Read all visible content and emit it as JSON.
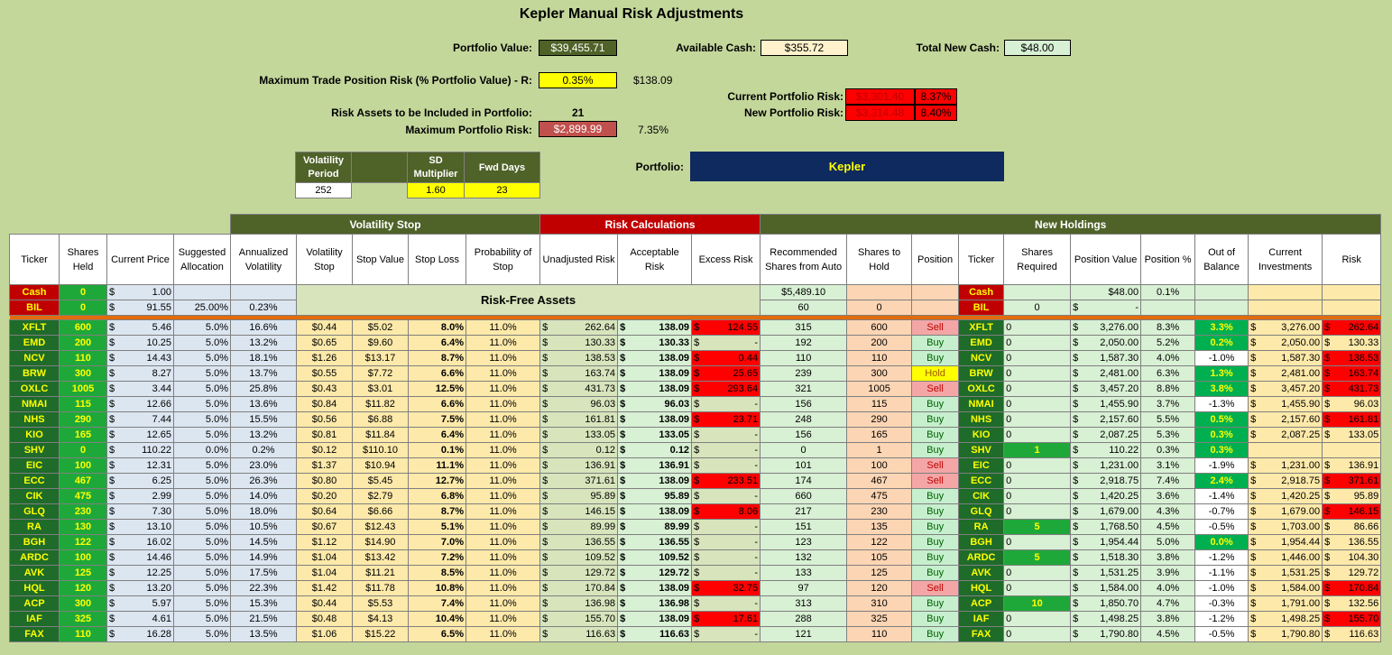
{
  "title": "Kepler Manual Risk Adjustments",
  "portfolio_value_label": "Portfolio Value:",
  "portfolio_value": "$39,455.71",
  "available_cash_label": "Available Cash:",
  "available_cash": "$355.72",
  "total_new_cash_label": "Total New Cash:",
  "total_new_cash": "$48.00",
  "max_trade_label": "Maximum Trade Position Risk (% Portfolio Value) - R:",
  "max_trade_pct": "0.35%",
  "max_trade_amt": "$138.09",
  "current_risk_label": "Current Portfolio Risk:",
  "current_risk_amt": "$3,301.40",
  "current_risk_pct": "8.37%",
  "new_risk_label": "New Portfolio Risk:",
  "new_risk_amt": "$3,314.48",
  "new_risk_pct": "8.40%",
  "risk_assets_label": "Risk Assets to be Included in Portfolio:",
  "risk_assets": "21",
  "max_portfolio_risk_label": "Maximum Portfolio Risk:",
  "max_portfolio_risk": "$2,899.99",
  "max_portfolio_risk_pct": "7.35%",
  "vol_period_label": "Volatility Period",
  "vol_period": "252",
  "sd_mult_label": "SD Multiplier",
  "sd_mult": "1.60",
  "fwd_days_label": "Fwd Days",
  "fwd_days": "23",
  "portfolio_label": "Portfolio:",
  "portfolio_name": "Kepler",
  "groups": {
    "vol": "Volatility Stop",
    "risk": "Risk Calculations",
    "new": "New Holdings"
  },
  "headers": [
    "Ticker",
    "Shares Held",
    "Current Price",
    "Suggested Allocation",
    "Annualized Volatility",
    "Volatility Stop",
    "Stop Value",
    "Stop Loss",
    "Probability of Stop",
    "Unadjusted Risk",
    "Acceptable Risk",
    "Excess Risk",
    "Recommended Shares from Auto",
    "Shares to Hold",
    "Position",
    "Ticker",
    "Shares Required",
    "Position Value",
    "Position %",
    "Out of Balance",
    "Current Investments",
    "Risk"
  ],
  "risk_free_label": "Risk-Free Assets",
  "cash_row": {
    "ticker": "Cash",
    "shares": "0",
    "price": "1.00",
    "rec": "$5,489.10",
    "ticker2": "Cash",
    "pos_value": "$48.00",
    "pos_pct": "0.1%"
  },
  "bil_row": {
    "ticker": "BIL",
    "shares": "0",
    "price": "91.55",
    "alloc": "25.00%",
    "vol": "0.23%",
    "rec": "60",
    "hold": "0",
    "ticker2": "BIL",
    "req": "0",
    "pos_value": "-"
  },
  "rows": [
    [
      "XFLT",
      "600",
      "5.46",
      "5.0%",
      "16.6%",
      "$0.44",
      "$5.02",
      "8.0%",
      "11.0%",
      "262.64",
      "138.09",
      "124.55",
      "315",
      "600",
      "Sell",
      "XFLT",
      "0",
      "3,276.00",
      "8.3%",
      "3.3%",
      "3,276.00",
      "262.64"
    ],
    [
      "EMD",
      "200",
      "10.25",
      "5.0%",
      "13.2%",
      "$0.65",
      "$9.60",
      "6.4%",
      "11.0%",
      "130.33",
      "130.33",
      "-",
      "192",
      "200",
      "Buy",
      "EMD",
      "0",
      "2,050.00",
      "5.2%",
      "0.2%",
      "2,050.00",
      "130.33"
    ],
    [
      "NCV",
      "110",
      "14.43",
      "5.0%",
      "18.1%",
      "$1.26",
      "$13.17",
      "8.7%",
      "11.0%",
      "138.53",
      "138.09",
      "0.44",
      "110",
      "110",
      "Buy",
      "NCV",
      "0",
      "1,587.30",
      "4.0%",
      "-1.0%",
      "1,587.30",
      "138.53"
    ],
    [
      "BRW",
      "300",
      "8.27",
      "5.0%",
      "13.7%",
      "$0.55",
      "$7.72",
      "6.6%",
      "11.0%",
      "163.74",
      "138.09",
      "25.65",
      "239",
      "300",
      "Hold",
      "BRW",
      "0",
      "2,481.00",
      "6.3%",
      "1.3%",
      "2,481.00",
      "163.74"
    ],
    [
      "OXLC",
      "1005",
      "3.44",
      "5.0%",
      "25.8%",
      "$0.43",
      "$3.01",
      "12.5%",
      "11.0%",
      "431.73",
      "138.09",
      "293.64",
      "321",
      "1005",
      "Sell",
      "OXLC",
      "0",
      "3,457.20",
      "8.8%",
      "3.8%",
      "3,457.20",
      "431.73"
    ],
    [
      "NMAI",
      "115",
      "12.66",
      "5.0%",
      "13.6%",
      "$0.84",
      "$11.82",
      "6.6%",
      "11.0%",
      "96.03",
      "96.03",
      "-",
      "156",
      "115",
      "Buy",
      "NMAI",
      "0",
      "1,455.90",
      "3.7%",
      "-1.3%",
      "1,455.90",
      "96.03"
    ],
    [
      "NHS",
      "290",
      "7.44",
      "5.0%",
      "15.5%",
      "$0.56",
      "$6.88",
      "7.5%",
      "11.0%",
      "161.81",
      "138.09",
      "23.71",
      "248",
      "290",
      "Buy",
      "NHS",
      "0",
      "2,157.60",
      "5.5%",
      "0.5%",
      "2,157.60",
      "161.81"
    ],
    [
      "KIO",
      "165",
      "12.65",
      "5.0%",
      "13.2%",
      "$0.81",
      "$11.84",
      "6.4%",
      "11.0%",
      "133.05",
      "133.05",
      "-",
      "156",
      "165",
      "Buy",
      "KIO",
      "0",
      "2,087.25",
      "5.3%",
      "0.3%",
      "2,087.25",
      "133.05"
    ],
    [
      "SHV",
      "0",
      "110.22",
      "0.0%",
      "0.2%",
      "$0.12",
      "$110.10",
      "0.1%",
      "11.0%",
      "0.12",
      "0.12",
      "-",
      "0",
      "1",
      "Buy",
      "SHV",
      "1",
      "110.22",
      "0.3%",
      "0.3%",
      "",
      ""
    ],
    [
      "EIC",
      "100",
      "12.31",
      "5.0%",
      "23.0%",
      "$1.37",
      "$10.94",
      "11.1%",
      "11.0%",
      "136.91",
      "136.91",
      "-",
      "101",
      "100",
      "Sell",
      "EIC",
      "0",
      "1,231.00",
      "3.1%",
      "-1.9%",
      "1,231.00",
      "136.91"
    ],
    [
      "ECC",
      "467",
      "6.25",
      "5.0%",
      "26.3%",
      "$0.80",
      "$5.45",
      "12.7%",
      "11.0%",
      "371.61",
      "138.09",
      "233.51",
      "174",
      "467",
      "Sell",
      "ECC",
      "0",
      "2,918.75",
      "7.4%",
      "2.4%",
      "2,918.75",
      "371.61"
    ],
    [
      "CIK",
      "475",
      "2.99",
      "5.0%",
      "14.0%",
      "$0.20",
      "$2.79",
      "6.8%",
      "11.0%",
      "95.89",
      "95.89",
      "-",
      "660",
      "475",
      "Buy",
      "CIK",
      "0",
      "1,420.25",
      "3.6%",
      "-1.4%",
      "1,420.25",
      "95.89"
    ],
    [
      "GLQ",
      "230",
      "7.30",
      "5.0%",
      "18.0%",
      "$0.64",
      "$6.66",
      "8.7%",
      "11.0%",
      "146.15",
      "138.09",
      "8.06",
      "217",
      "230",
      "Buy",
      "GLQ",
      "0",
      "1,679.00",
      "4.3%",
      "-0.7%",
      "1,679.00",
      "146.15"
    ],
    [
      "RA",
      "130",
      "13.10",
      "5.0%",
      "10.5%",
      "$0.67",
      "$12.43",
      "5.1%",
      "11.0%",
      "89.99",
      "89.99",
      "-",
      "151",
      "135",
      "Buy",
      "RA",
      "5",
      "1,768.50",
      "4.5%",
      "-0.5%",
      "1,703.00",
      "86.66"
    ],
    [
      "BGH",
      "122",
      "16.02",
      "5.0%",
      "14.5%",
      "$1.12",
      "$14.90",
      "7.0%",
      "11.0%",
      "136.55",
      "136.55",
      "-",
      "123",
      "122",
      "Buy",
      "BGH",
      "0",
      "1,954.44",
      "5.0%",
      "0.0%",
      "1,954.44",
      "136.55"
    ],
    [
      "ARDC",
      "100",
      "14.46",
      "5.0%",
      "14.9%",
      "$1.04",
      "$13.42",
      "7.2%",
      "11.0%",
      "109.52",
      "109.52",
      "-",
      "132",
      "105",
      "Buy",
      "ARDC",
      "5",
      "1,518.30",
      "3.8%",
      "-1.2%",
      "1,446.00",
      "104.30"
    ],
    [
      "AVK",
      "125",
      "12.25",
      "5.0%",
      "17.5%",
      "$1.04",
      "$11.21",
      "8.5%",
      "11.0%",
      "129.72",
      "129.72",
      "-",
      "133",
      "125",
      "Buy",
      "AVK",
      "0",
      "1,531.25",
      "3.9%",
      "-1.1%",
      "1,531.25",
      "129.72"
    ],
    [
      "HQL",
      "120",
      "13.20",
      "5.0%",
      "22.3%",
      "$1.42",
      "$11.78",
      "10.8%",
      "11.0%",
      "170.84",
      "138.09",
      "32.75",
      "97",
      "120",
      "Sell",
      "HQL",
      "0",
      "1,584.00",
      "4.0%",
      "-1.0%",
      "1,584.00",
      "170.84"
    ],
    [
      "ACP",
      "300",
      "5.97",
      "5.0%",
      "15.3%",
      "$0.44",
      "$5.53",
      "7.4%",
      "11.0%",
      "136.98",
      "136.98",
      "-",
      "313",
      "310",
      "Buy",
      "ACP",
      "10",
      "1,850.70",
      "4.7%",
      "-0.3%",
      "1,791.00",
      "132.56"
    ],
    [
      "IAF",
      "325",
      "4.61",
      "5.0%",
      "21.5%",
      "$0.48",
      "$4.13",
      "10.4%",
      "11.0%",
      "155.70",
      "138.09",
      "17.61",
      "288",
      "325",
      "Buy",
      "IAF",
      "0",
      "1,498.25",
      "3.8%",
      "-1.2%",
      "1,498.25",
      "155.70"
    ],
    [
      "FAX",
      "110",
      "16.28",
      "5.0%",
      "13.5%",
      "$1.06",
      "$15.22",
      "6.5%",
      "11.0%",
      "116.63",
      "116.63",
      "-",
      "121",
      "110",
      "Buy",
      "FAX",
      "0",
      "1,790.80",
      "4.5%",
      "-0.5%",
      "1,790.80",
      "116.63"
    ]
  ]
}
